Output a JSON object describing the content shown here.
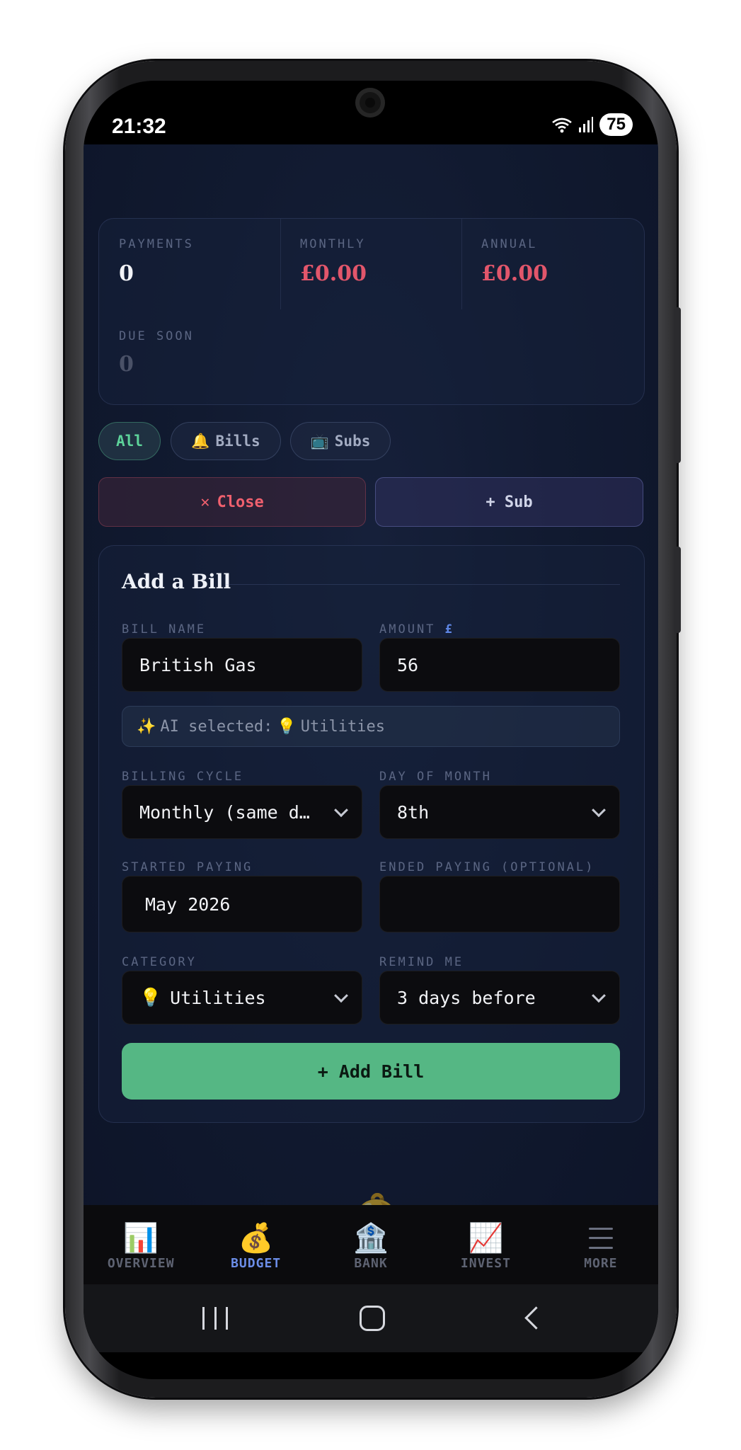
{
  "status_bar": {
    "time": "21:32",
    "battery": "75"
  },
  "summary": {
    "payments_label": "PAYMENTS",
    "payments_value": "0",
    "monthly_label": "MONTHLY",
    "monthly_value": "£0.00",
    "annual_label": "ANNUAL",
    "annual_value": "£0.00",
    "due_soon_label": "DUE SOON",
    "due_soon_value": "0"
  },
  "filters": {
    "all": "All",
    "bills": "Bills",
    "subs": "Subs"
  },
  "actions": {
    "close": "Close",
    "sub": "+ Sub"
  },
  "form": {
    "title": "Add a Bill",
    "bill_name_label": "BILL NAME",
    "bill_name_value": "British Gas",
    "amount_label": "AMOUNT",
    "amount_currency": "£",
    "amount_value": "56",
    "ai_text": "AI selected:",
    "ai_category": "Utilities",
    "billing_cycle_label": "BILLING CYCLE",
    "billing_cycle_value": "Monthly (same d…",
    "day_label": "DAY OF MONTH",
    "day_value": "8th",
    "started_label": "STARTED PAYING",
    "started_value": "May 2026",
    "ended_label": "ENDED PAYING (OPTIONAL)",
    "ended_value": "",
    "category_label": "CATEGORY",
    "category_value": "Utilities",
    "remind_label": "REMIND ME",
    "remind_value": "3 days before",
    "submit": "+ Add Bill"
  },
  "nav": {
    "overview": "OVERVIEW",
    "budget": "BUDGET",
    "bank": "BANK",
    "invest": "INVEST",
    "more": "MORE"
  },
  "colors": {
    "accent_green": "#55b784",
    "danger_red": "#f0606e",
    "active_blue": "#6c8ee8",
    "money_value": "#e2566b"
  }
}
